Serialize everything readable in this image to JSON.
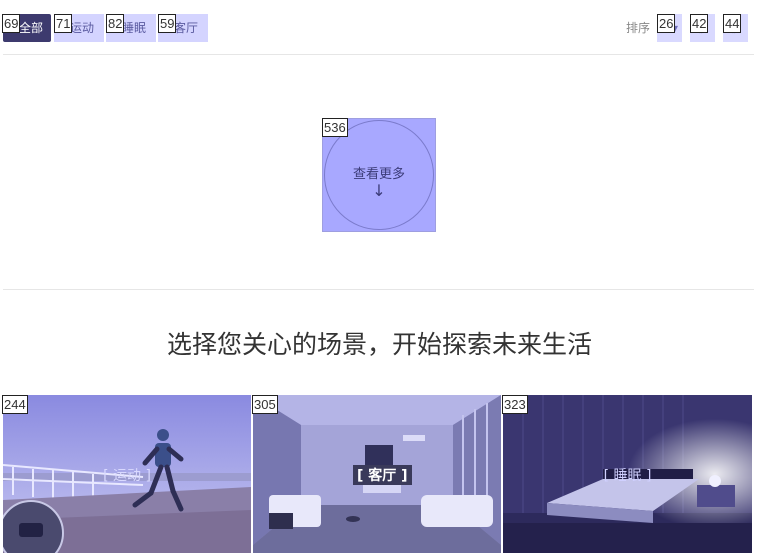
{
  "filters": {
    "tabs": [
      {
        "label": "全部",
        "tag": "69"
      },
      {
        "label": "运动",
        "tag": "71"
      },
      {
        "label": "睡眠",
        "tag": "82"
      },
      {
        "label": "客厅",
        "tag": "59"
      }
    ]
  },
  "sort": {
    "label": "排序",
    "buttons": [
      {
        "tag": "26",
        "glyph": "▾"
      },
      {
        "tag": "42",
        "glyph": "》"
      },
      {
        "tag": "44",
        "glyph": "》"
      }
    ]
  },
  "load_more": {
    "tag": "536",
    "label": "查看更多",
    "arrow": "↓"
  },
  "headline": "选择您关心的场景，开始探索未来生活",
  "scenes": [
    {
      "tag": "244",
      "label": "[ 运动 ]"
    },
    {
      "tag": "305",
      "label": "[ 客厅 ]"
    },
    {
      "tag": "323",
      "label": "[ 睡眠 ]"
    }
  ],
  "colors": {
    "tab_active_bg": "#3d3a6e",
    "tab_bg": "#d4d4ff",
    "accent_purple": "#a8a8ff"
  }
}
